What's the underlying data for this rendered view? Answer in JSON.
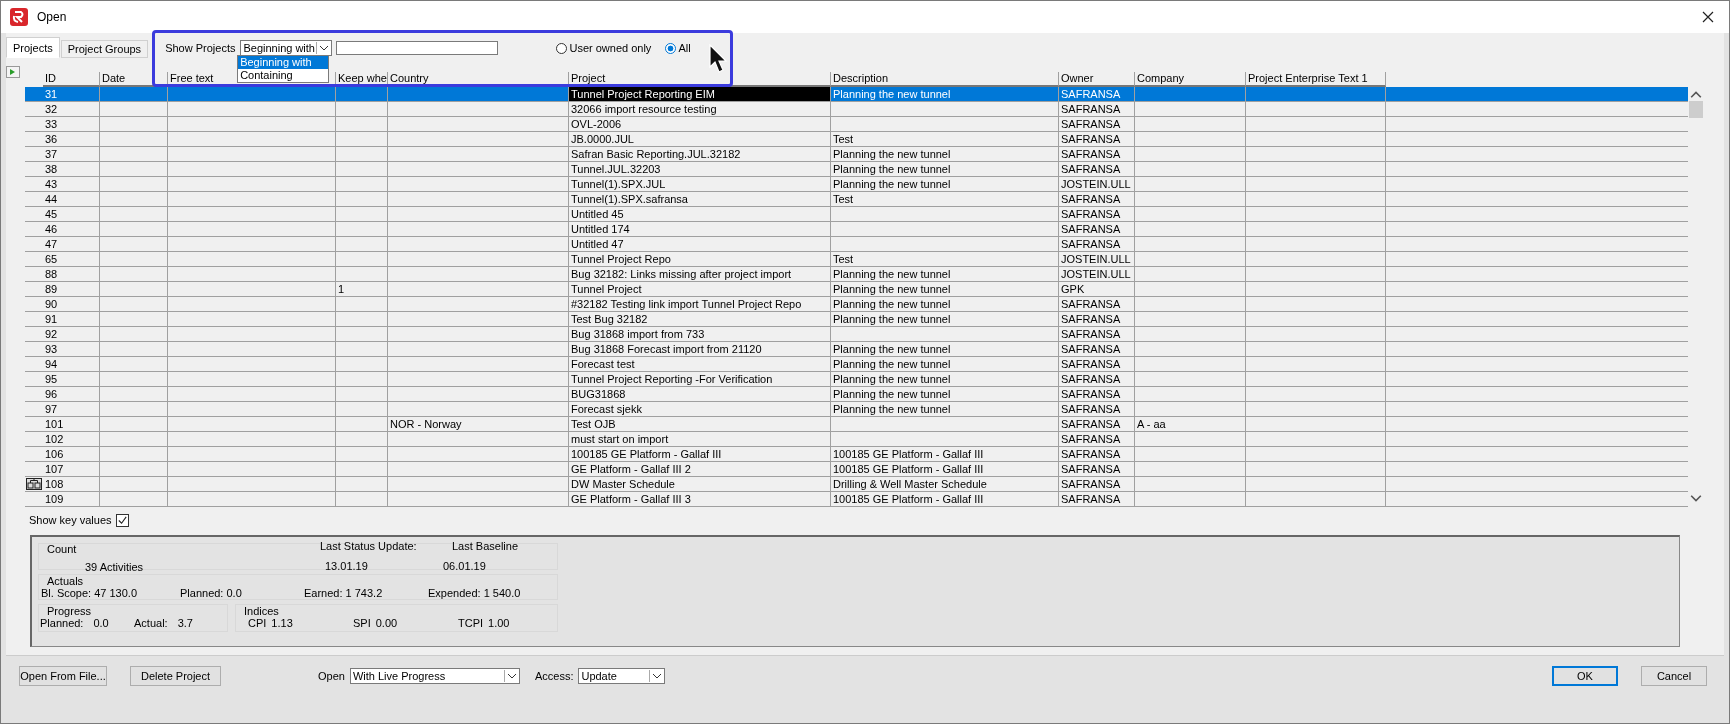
{
  "window": {
    "title": "Open"
  },
  "tabs": [
    {
      "label": "Projects",
      "selected": true
    },
    {
      "label": "Project Groups",
      "selected": false
    }
  ],
  "filter": {
    "label": "Show Projects",
    "mode": "Beginning with",
    "options": [
      {
        "label": "Beginning with",
        "selected": true
      },
      {
        "label": "Containing",
        "selected": false
      }
    ],
    "radios": [
      {
        "label": "User owned only",
        "selected": false
      },
      {
        "label": "All",
        "selected": true
      }
    ]
  },
  "table": {
    "columns": [
      {
        "label": "ID",
        "focused": false
      },
      {
        "label": "Date",
        "focused": false
      },
      {
        "label": "Free text",
        "focused": false
      },
      {
        "label": "Keep whe",
        "focused": false
      },
      {
        "label": "Country",
        "focused": false
      },
      {
        "label": "Project",
        "focused": true
      },
      {
        "label": "Description",
        "focused": false
      },
      {
        "label": "Owner",
        "focused": false
      },
      {
        "label": "Company",
        "focused": false
      },
      {
        "label": "Project Enterprise Text 1",
        "focused": false
      }
    ],
    "rows": [
      {
        "selected": true,
        "cells": [
          "31",
          null,
          null,
          null,
          null,
          "Tunnel Project Reporting EIM",
          "Planning the new tunnel",
          "SAFRANSA",
          null,
          null
        ]
      },
      {
        "selected": false,
        "cells": [
          "32",
          null,
          null,
          null,
          null,
          "32066 import resource testing",
          null,
          "SAFRANSA",
          null,
          null
        ]
      },
      {
        "selected": false,
        "cells": [
          "33",
          null,
          null,
          null,
          null,
          "OVL-2006",
          null,
          "SAFRANSA",
          null,
          null
        ]
      },
      {
        "selected": false,
        "cells": [
          "36",
          null,
          null,
          null,
          null,
          "JB.0000.JUL",
          "Test",
          "SAFRANSA",
          null,
          null
        ]
      },
      {
        "selected": false,
        "cells": [
          "37",
          null,
          null,
          null,
          null,
          "Safran Basic Reporting.JUL.32182",
          "Planning the new tunnel",
          "SAFRANSA",
          null,
          null
        ]
      },
      {
        "selected": false,
        "cells": [
          "38",
          null,
          null,
          null,
          null,
          "Tunnel.JUL.32203",
          "Planning the new tunnel",
          "SAFRANSA",
          null,
          null
        ]
      },
      {
        "selected": false,
        "cells": [
          "43",
          null,
          null,
          null,
          null,
          "Tunnel(1).SPX.JUL",
          "Planning the new tunnel",
          "JOSTEIN.ULL",
          null,
          null
        ]
      },
      {
        "selected": false,
        "cells": [
          "44",
          null,
          null,
          null,
          null,
          "Tunnel(1).SPX.safransa",
          "Test",
          "SAFRANSA",
          null,
          null
        ]
      },
      {
        "selected": false,
        "cells": [
          "45",
          null,
          null,
          null,
          null,
          "Untitled 45",
          null,
          "SAFRANSA",
          null,
          null
        ]
      },
      {
        "selected": false,
        "cells": [
          "46",
          null,
          null,
          null,
          null,
          "Untitled 174",
          null,
          "SAFRANSA",
          null,
          null
        ]
      },
      {
        "selected": false,
        "cells": [
          "47",
          null,
          null,
          null,
          null,
          "Untitled 47",
          null,
          "SAFRANSA",
          null,
          null
        ]
      },
      {
        "selected": false,
        "cells": [
          "65",
          null,
          null,
          null,
          null,
          "Tunnel Project Repo",
          "Test",
          "JOSTEIN.ULL",
          null,
          null
        ]
      },
      {
        "selected": false,
        "cells": [
          "88",
          null,
          null,
          null,
          null,
          "Bug 32182: Links missing after project import",
          "Planning the new tunnel",
          "JOSTEIN.ULL",
          null,
          null
        ]
      },
      {
        "selected": false,
        "cells": [
          "89",
          null,
          null,
          "1",
          null,
          "Tunnel Project",
          "Planning the new tunnel",
          "GPK",
          null,
          null
        ]
      },
      {
        "selected": false,
        "cells": [
          "90",
          null,
          null,
          null,
          null,
          "#32182 Testing link import Tunnel Project Repo",
          "Planning the new tunnel",
          "SAFRANSA",
          null,
          null
        ]
      },
      {
        "selected": false,
        "cells": [
          "91",
          null,
          null,
          null,
          null,
          "Test Bug 32182",
          "Planning the new tunnel",
          "SAFRANSA",
          null,
          null
        ]
      },
      {
        "selected": false,
        "cells": [
          "92",
          null,
          null,
          null,
          null,
          "Bug 31868 import from 733",
          null,
          "SAFRANSA",
          null,
          null
        ]
      },
      {
        "selected": false,
        "cells": [
          "93",
          null,
          null,
          null,
          null,
          "Bug 31868 Forecast import from 21120",
          "Planning the new tunnel",
          "SAFRANSA",
          null,
          null
        ]
      },
      {
        "selected": false,
        "cells": [
          "94",
          null,
          null,
          null,
          null,
          "Forecast test",
          "Planning the new tunnel",
          "SAFRANSA",
          null,
          null
        ]
      },
      {
        "selected": false,
        "cells": [
          "95",
          null,
          null,
          null,
          null,
          "Tunnel Project Reporting -For Verification",
          "Planning the new tunnel",
          "SAFRANSA",
          null,
          null
        ]
      },
      {
        "selected": false,
        "cells": [
          "96",
          null,
          null,
          null,
          null,
          "BUG31868",
          "Planning the new tunnel",
          "SAFRANSA",
          null,
          null
        ]
      },
      {
        "selected": false,
        "cells": [
          "97",
          null,
          null,
          null,
          null,
          "Forecast sjekk",
          "Planning the new tunnel",
          "SAFRANSA",
          null,
          null
        ]
      },
      {
        "selected": false,
        "cells": [
          "101",
          null,
          null,
          null,
          "NOR - Norway",
          "Test OJB",
          null,
          "SAFRANSA",
          "A - aa",
          null
        ]
      },
      {
        "selected": false,
        "cells": [
          "102",
          null,
          null,
          null,
          null,
          "must start on import",
          null,
          "SAFRANSA",
          null,
          null
        ]
      },
      {
        "selected": false,
        "cells": [
          "106",
          null,
          null,
          null,
          null,
          "100185 GE Platform - Gallaf III",
          "100185 GE Platform - Gallaf III",
          "SAFRANSA",
          null,
          null
        ]
      },
      {
        "selected": false,
        "cells": [
          "107",
          null,
          null,
          null,
          null,
          "GE Platform - Gallaf III 2",
          "100185 GE Platform - Gallaf III",
          "SAFRANSA",
          null,
          null
        ]
      },
      {
        "selected": false,
        "kind": "linked",
        "cells": [
          "108",
          null,
          null,
          null,
          null,
          "DW Master Schedule",
          "Drilling & Well Master Schedule",
          "SAFRANSA",
          null,
          null
        ]
      },
      {
        "selected": false,
        "cells": [
          "109",
          null,
          null,
          null,
          null,
          "GE Platform - Gallaf III 3",
          "100185 GE Platform - Gallaf III",
          "SAFRANSA",
          null,
          null
        ]
      }
    ]
  },
  "summary": {
    "show_key_values": {
      "label": "Show key values",
      "checked": true
    },
    "count": {
      "title": "Count",
      "value": "39 Activities"
    },
    "last_status_update": {
      "label": "Last Status Update:",
      "value": "13.01.19"
    },
    "last_baseline": {
      "label": "Last Baseline",
      "value": "06.01.19"
    },
    "actuals": {
      "title": "Actuals",
      "items": [
        "Bl. Scope: 47 130.0",
        "Planned: 0.0",
        "Earned: 1 743.2",
        "Expended: 1 540.0"
      ]
    },
    "progress": {
      "title": "Progress",
      "items": [
        {
          "label": "Planned:",
          "value": "0.0"
        },
        {
          "label": "Actual:",
          "value": "3.7"
        }
      ]
    },
    "indices": {
      "title": "Indices",
      "items": [
        {
          "label": "CPI",
          "value": "1.13"
        },
        {
          "label": "SPI",
          "value": "0.00"
        },
        {
          "label": "TCPI",
          "value": "1.00"
        }
      ]
    }
  },
  "footer": {
    "buttons": [
      "Open From File...",
      "Delete Project"
    ],
    "open": {
      "label": "Open",
      "value": "With Live Progress"
    },
    "access": {
      "label": "Access:",
      "value": "Update"
    },
    "ok": "OK",
    "cancel": "Cancel"
  }
}
